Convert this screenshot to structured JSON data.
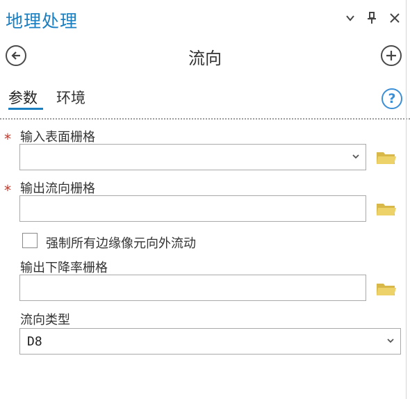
{
  "pane": {
    "title": "地理处理",
    "controls": {
      "menu_icon": "chevron-down-icon",
      "pin_icon": "pin-icon",
      "close_icon": "close-icon"
    }
  },
  "tool": {
    "back_icon": "back-arrow-icon",
    "title": "流向",
    "add_icon": "plus-icon"
  },
  "tabs": [
    {
      "label": "参数",
      "active": true
    },
    {
      "label": "环境",
      "active": false
    }
  ],
  "help_label": "?",
  "params": {
    "input_surface": {
      "label": "输入表面栅格",
      "required_mark": "*",
      "value": ""
    },
    "output_flow_dir": {
      "label": "输出流向栅格",
      "required_mark": "*",
      "value": ""
    },
    "force_flow": {
      "label": "强制所有边缘像元向外流动",
      "checked": false
    },
    "output_drop": {
      "label": "输出下降率栅格",
      "value": ""
    },
    "flow_type": {
      "label": "流向类型",
      "value": "D8"
    }
  },
  "colors": {
    "accent": "#1a7fc1",
    "required": "#c0392b",
    "folder": "#e0c34f"
  }
}
